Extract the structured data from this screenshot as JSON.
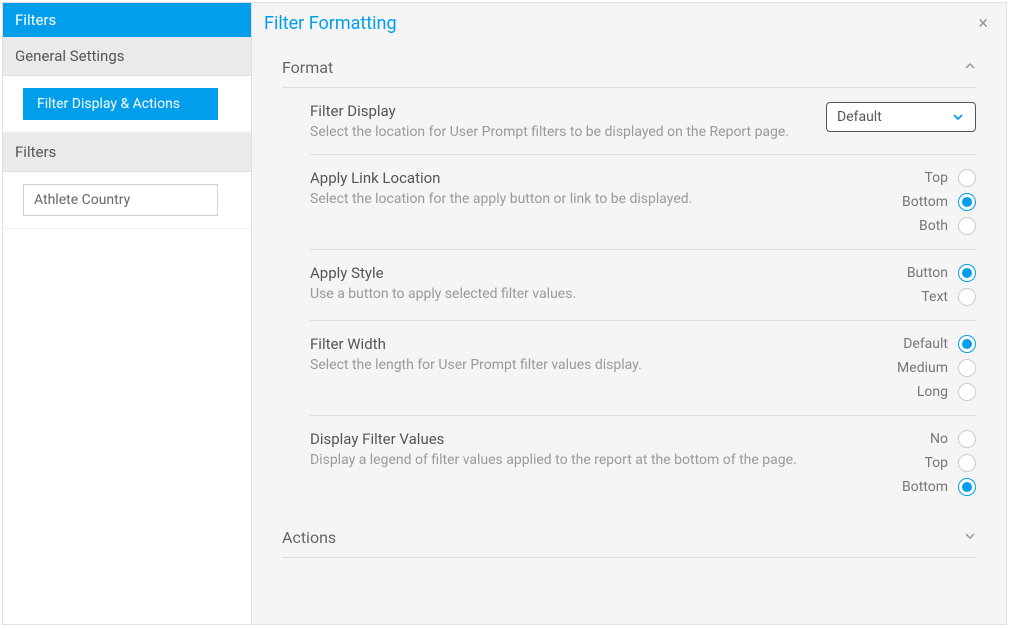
{
  "sidebar": {
    "title": "Filters",
    "section_general": "General Settings",
    "item_filter_display": "Filter Display & Actions",
    "section_filters": "Filters",
    "filter_item": "Athlete Country"
  },
  "main": {
    "title": "Filter Formatting",
    "format_section": "Format",
    "actions_section": "Actions",
    "filter_display": {
      "label": "Filter Display",
      "desc": "Select the location for User Prompt filters to be displayed on the Report page.",
      "value": "Default"
    },
    "apply_link": {
      "label": "Apply Link Location",
      "desc": "Select the location for the apply button or link to be displayed.",
      "options": {
        "top": "Top",
        "bottom": "Bottom",
        "both": "Both"
      },
      "selected": "bottom"
    },
    "apply_style": {
      "label": "Apply Style",
      "desc": "Use a button to apply selected filter values.",
      "options": {
        "button": "Button",
        "text": "Text"
      },
      "selected": "button"
    },
    "filter_width": {
      "label": "Filter Width",
      "desc": "Select the length for User Prompt filter values display.",
      "options": {
        "default": "Default",
        "medium": "Medium",
        "long": "Long"
      },
      "selected": "default"
    },
    "display_values": {
      "label": "Display Filter Values",
      "desc": "Display a legend of filter values applied to the report at the bottom of the page.",
      "options": {
        "no": "No",
        "top": "Top",
        "bottom": "Bottom"
      },
      "selected": "bottom"
    }
  }
}
